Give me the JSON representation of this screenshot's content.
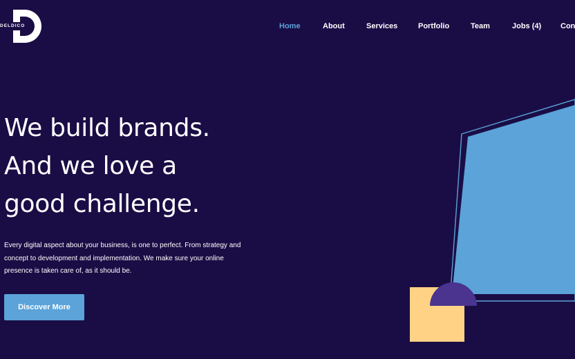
{
  "brand": {
    "logo_text": "DELDICO"
  },
  "nav": {
    "items": [
      {
        "label": "Home",
        "active": true
      },
      {
        "label": "About",
        "active": false
      },
      {
        "label": "Services",
        "active": false
      },
      {
        "label": "Portfolio",
        "active": false
      },
      {
        "label": "Team",
        "active": false
      },
      {
        "label": "Jobs (4)",
        "active": false
      },
      {
        "label": "Con",
        "active": false
      }
    ]
  },
  "hero": {
    "title_lines": [
      "We build brands.",
      "And we love a",
      "good challenge."
    ],
    "text": "Every digital aspect about your business, is one to perfect. From strategy and concept to development and implementation. We make sure your online presence is taken care of, as it should be.",
    "cta_label": "Discover More"
  },
  "colors": {
    "background": "#1a0d45",
    "accent": "#5ba3d9",
    "yellow": "#ffd285",
    "purple": "#4a3490",
    "white": "#ffffff"
  }
}
